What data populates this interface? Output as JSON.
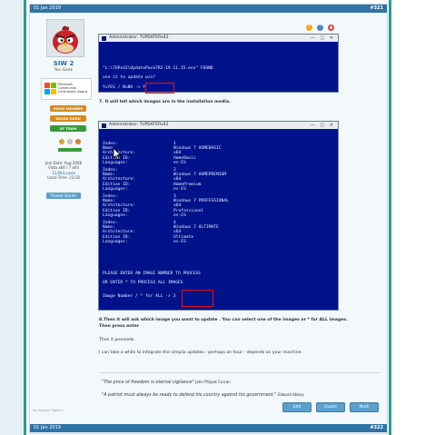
{
  "post_header": {
    "date": "01 Jan 2019",
    "number": "#321"
  },
  "post_footer": {
    "date": "01 Jan 2019",
    "number": "#322"
  },
  "user": {
    "name": "SIW 2",
    "title": "Yes Geek",
    "mcc_label": "Microsoft Community Contributor Award",
    "badges": [
      {
        "label": "GOOD MEMBER",
        "color": "#d48a20"
      },
      {
        "label": "SEVEN GURU",
        "color": "#d48a20"
      },
      {
        "label": "SF TEAM",
        "color": "#3a9a3a"
      }
    ],
    "stats": {
      "join_date": "Join Date: Aug 2008",
      "system": "Vista x64 / 7 x64",
      "posts": "13,844 posts",
      "local_time": "Local Time: 23:18"
    },
    "starter_badge": "Thread Starter",
    "signature_link": "My System Specs >"
  },
  "toolbar_icons": [
    "warning-icon",
    "quote-icon",
    "report-icon"
  ],
  "cmd1": {
    "title": "Administrator: 7UPDATERx42",
    "lines": [
      "\"L:\\7UPx42\\UpdatePack7R2-19.11.15.exe\" FOUND",
      "",
      "use it to update win?",
      "",
      "Y=YES / N=NO -> Y"
    ]
  },
  "step7": "7. It will tell which images are in the installation media.",
  "cmd2": {
    "title": "Administrator: 7UPDATERx42",
    "field_labels": [
      "Index:",
      "Name:",
      "Architecture:",
      "Edition ID:",
      "Languages:"
    ],
    "images": [
      {
        "index": "1",
        "name": "Windows 7 HOMEBASIC",
        "arch": "x64",
        "edition": "HomeBasic",
        "lang": "es-ES"
      },
      {
        "index": "2",
        "name": "Windows 7 HOMEPREMIUM",
        "arch": "x64",
        "edition": "HomePremium",
        "lang": "es-ES"
      },
      {
        "index": "3",
        "name": "Windows 7 PROFESSIONAL",
        "arch": "x64",
        "edition": "Professional",
        "lang": "es-ES"
      },
      {
        "index": "4",
        "name": "Windows 7 ULTIMATE",
        "arch": "x64",
        "edition": "Ultimate",
        "lang": "es-ES"
      }
    ],
    "prompt1": "PLEASE ENTER AN IMAGE NUMBER TO PROCESS",
    "prompt2": "OR ENTER * TO PROCESS ALL IMAGES",
    "input_line": "Image Number / * for ALL -> 3"
  },
  "step8_line1": "8.Then it will ask which image you want to update . You can select one of the images or * for ALL images.",
  "step8_line2": "Then press enter",
  "proceeds": "Then it proceeds.",
  "integrate": "I can take a while to integrate the simplix updates - perhaps an hour - depends on your machine.",
  "quotes": [
    {
      "text": "\"The price of freedom is eternal vigilance\"",
      "author": "John Philpot Curran"
    },
    {
      "text": "\"A patriot must always be ready to defend his country against his government.\"",
      "author": "Edward Abbey"
    }
  ],
  "buttons": {
    "edit": "Edit",
    "quote": "Quote",
    "multi": "Multi"
  }
}
